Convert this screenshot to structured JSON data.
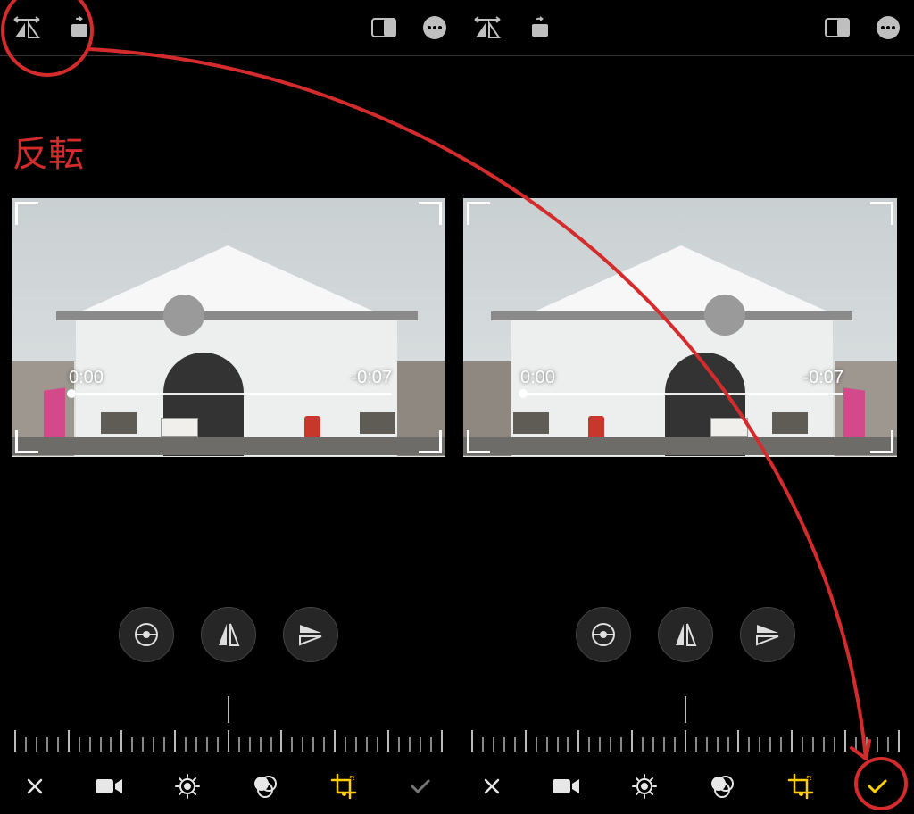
{
  "annotation_label": "反転",
  "preview_left": {
    "time_start": "0:00",
    "time_end": "-0:07"
  },
  "preview_right": {
    "time_start": "0:00",
    "time_end": "-0:07"
  },
  "colors": {
    "accent": "#ffcf00",
    "annotation": "#d42c2c"
  },
  "topbar": {
    "left": [
      "flip-horizontal-icon",
      "rotate-icon"
    ],
    "center": [
      "aspect-icon",
      "more-icon",
      "flip-horizontal-icon",
      "rotate-icon"
    ],
    "right": [
      "aspect-icon",
      "more-icon"
    ]
  },
  "adjust_buttons": [
    "straighten-icon",
    "flip-vertical-icon",
    "flip-horizontal-small-icon"
  ],
  "bottom_left": [
    "cancel-button",
    "video-button",
    "adjust-button",
    "filters-button",
    "crop-button",
    "confirm-button"
  ],
  "bottom_right": [
    "cancel-button",
    "video-button",
    "adjust-button",
    "filters-button",
    "crop-button",
    "confirm-button"
  ]
}
